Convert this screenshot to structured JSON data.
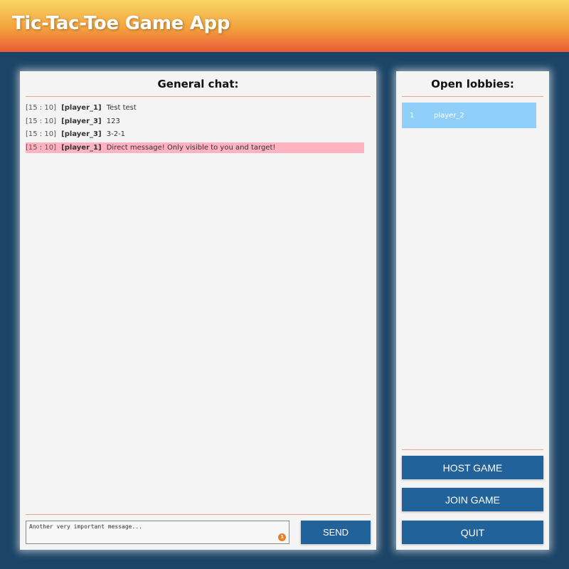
{
  "app": {
    "title": "Tic-Tac-Toe Game App"
  },
  "chat": {
    "title": "General chat:",
    "messages": [
      {
        "time": "[15 : 10]",
        "user": "[player_1]",
        "text": "Test test",
        "direct": false
      },
      {
        "time": "[15 : 10]",
        "user": "[player_3]",
        "text": "123",
        "direct": false
      },
      {
        "time": "[15 : 10]",
        "user": "[player_3]",
        "text": "3-2-1",
        "direct": false
      },
      {
        "time": "[15 : 10]",
        "user": "[player_1]",
        "text": "Direct message! Only visible to you and target!",
        "direct": true
      }
    ],
    "input_value": "Another very important message...",
    "input_badge": "1",
    "send_label": "SEND"
  },
  "lobbies": {
    "title": "Open lobbies:",
    "items": [
      {
        "number": "1",
        "name": "player_2"
      }
    ],
    "host_label": "HOST GAME",
    "join_label": "JOIN GAME",
    "quit_label": "QUIT"
  },
  "colors": {
    "background": "#1c4466",
    "button": "#21629a",
    "direct_message": "#ffb3c0",
    "lobby_row": "#8fcff9",
    "divider": "#e8a48e"
  }
}
